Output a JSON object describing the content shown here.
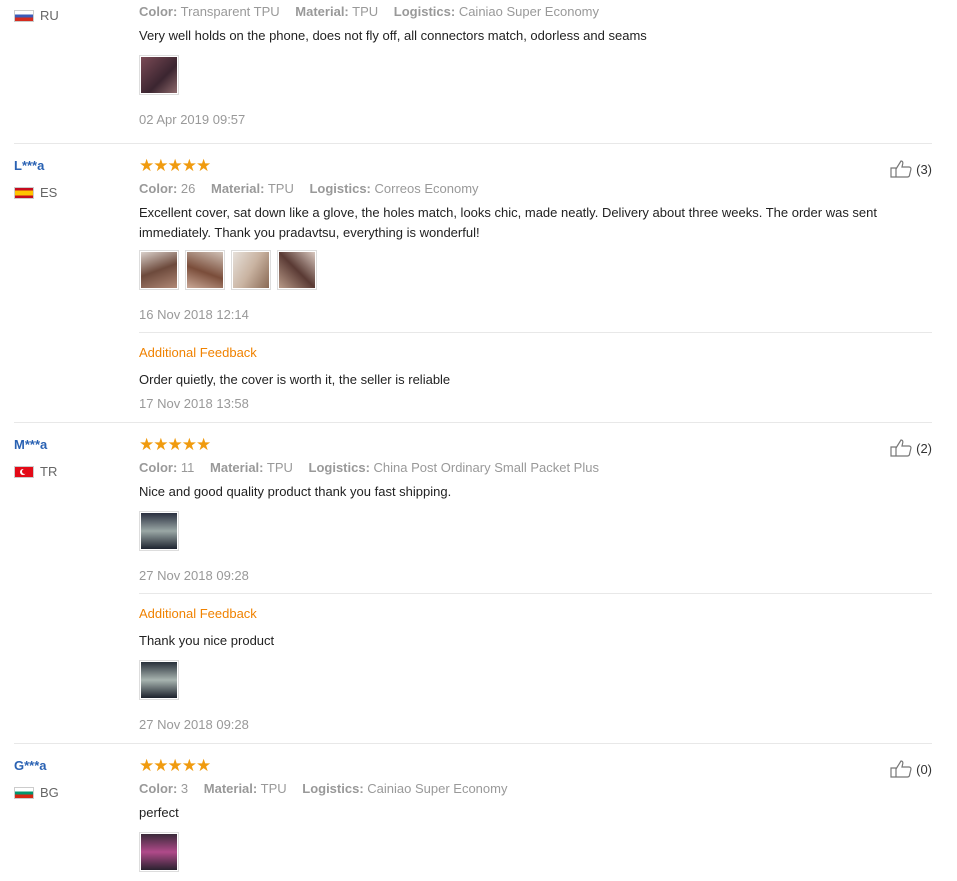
{
  "labels": {
    "color": "Color:",
    "material": "Material:",
    "logistics": "Logistics:",
    "additional_feedback": "Additional Feedback"
  },
  "reviews": [
    {
      "country": "RU",
      "color": "Transparent TPU",
      "material": "TPU",
      "logistics": "Cainiao Super Economy",
      "text": "Very well holds on the phone, does not fly off, all connectors match, odorless and seams",
      "date": "02 Apr 2019 09:57"
    },
    {
      "buyer": "L***a",
      "country": "ES",
      "helpful": "(3)",
      "color": "26",
      "material": "TPU",
      "logistics": "Correos Economy",
      "text": "Excellent cover, sat down like a glove, the holes match, looks chic, made neatly. Delivery about three weeks. The order was sent immediately. Thank you pradavtsu, everything is wonderful!",
      "date": "16 Nov 2018 12:14",
      "additional": {
        "text": "Order quietly, the cover is worth it, the seller is reliable",
        "date": "17 Nov 2018 13:58"
      }
    },
    {
      "buyer": "M***a",
      "country": "TR",
      "helpful": "(2)",
      "color": "11",
      "material": "TPU",
      "logistics": "China Post Ordinary Small Packet Plus",
      "text": "Nice and good quality product thank you fast shipping.",
      "date": "27 Nov 2018 09:28",
      "additional": {
        "text": "Thank you nice product",
        "date": "27 Nov 2018 09:28"
      }
    },
    {
      "buyer": "G***a",
      "country": "BG",
      "helpful": "(0)",
      "color": "3",
      "material": "TPU",
      "logistics": "Cainiao Super Economy",
      "text": "perfect"
    }
  ],
  "rating_stars": 5,
  "colors": {
    "star": "#f09b0f",
    "buyer_link": "#2a62b3",
    "additional_feedback": "#f08200"
  }
}
